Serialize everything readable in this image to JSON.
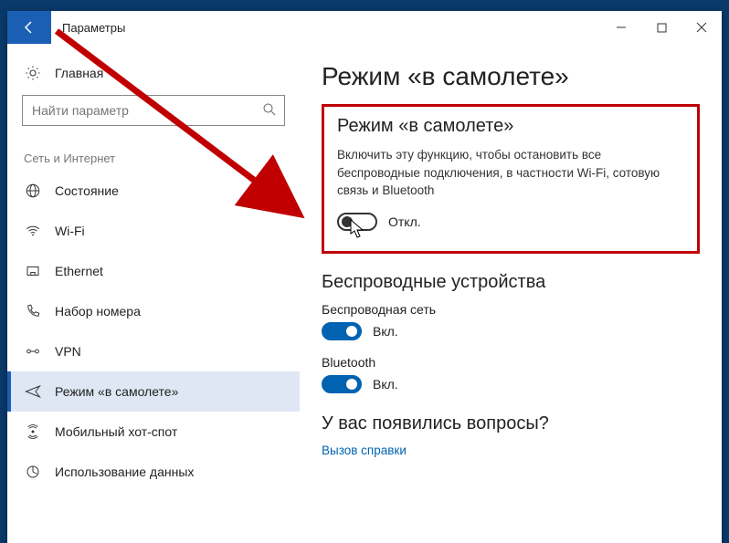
{
  "window": {
    "title": "Параметры"
  },
  "sidebar": {
    "home_label": "Главная",
    "search_placeholder": "Найти параметр",
    "category_title": "Сеть и Интернет",
    "items": [
      {
        "label": "Состояние"
      },
      {
        "label": "Wi-Fi"
      },
      {
        "label": "Ethernet"
      },
      {
        "label": "Набор номера"
      },
      {
        "label": "VPN"
      },
      {
        "label": "Режим «в самолете»"
      },
      {
        "label": "Мобильный хот-спот"
      },
      {
        "label": "Использование данных"
      }
    ]
  },
  "content": {
    "page_title": "Режим «в самолете»",
    "airplane": {
      "section_title": "Режим «в самолете»",
      "description": "Включить эту функцию, чтобы остановить все беспроводные подключения, в частности Wi-Fi, сотовую связь и Bluetooth",
      "toggle_state_label": "Откл."
    },
    "wireless": {
      "section_title": "Беспроводные устройства",
      "wifi_label": "Беспроводная сеть",
      "wifi_state_label": "Вкл.",
      "bt_label": "Bluetooth",
      "bt_state_label": "Вкл."
    },
    "help": {
      "section_title": "У вас появились вопросы?",
      "link_label": "Вызов справки"
    }
  }
}
